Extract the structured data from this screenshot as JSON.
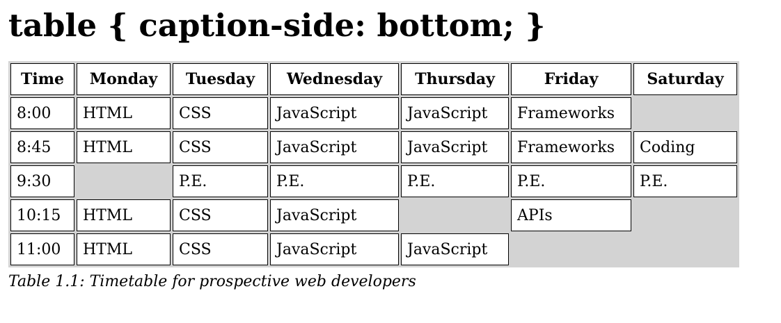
{
  "heading": "table { caption-side: bottom; }",
  "table": {
    "headers": [
      "Time",
      "Monday",
      "Tuesday",
      "Wednesday",
      "Thursday",
      "Friday",
      "Saturday"
    ],
    "rows": [
      [
        "8:00",
        "HTML",
        "CSS",
        "JavaScript",
        "JavaScript",
        "Frameworks",
        ""
      ],
      [
        "8:45",
        "HTML",
        "CSS",
        "JavaScript",
        "JavaScript",
        "Frameworks",
        "Coding"
      ],
      [
        "9:30",
        "",
        "P.E.",
        "P.E.",
        "P.E.",
        "P.E.",
        "P.E."
      ],
      [
        "10:15",
        "HTML",
        "CSS",
        "JavaScript",
        "",
        "APIs",
        ""
      ],
      [
        "11:00",
        "HTML",
        "CSS",
        "JavaScript",
        "JavaScript",
        "",
        ""
      ]
    ],
    "caption": "Table 1.1: Timetable for prospective web developers"
  },
  "colors": {
    "table_background": "#d3d3d3",
    "cell_background": "#ffffff",
    "border": "#000000"
  }
}
